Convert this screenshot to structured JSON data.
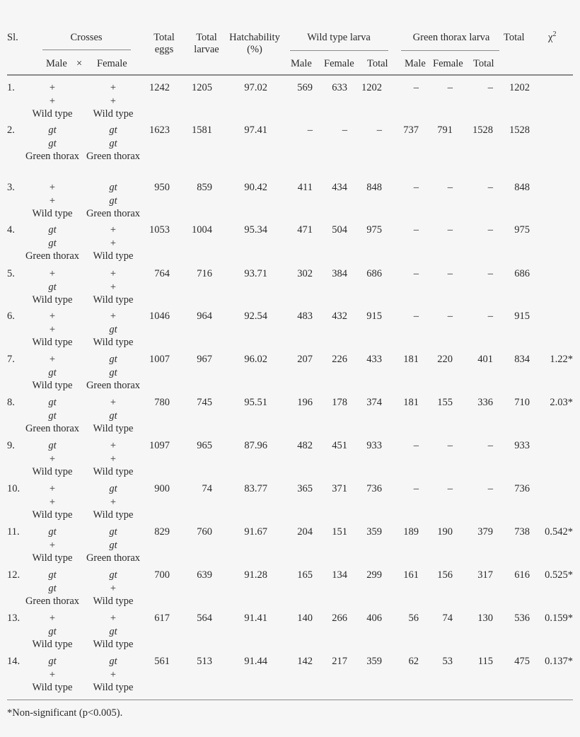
{
  "table": {
    "header": {
      "sl": "Sl.",
      "crosses": "Crosses",
      "male": "Male",
      "times": "×",
      "female": "Female",
      "total_eggs": [
        "Total",
        "eggs"
      ],
      "total_larvae": [
        "Total",
        "larvae"
      ],
      "hatchability": [
        "Hatchability",
        "(%)"
      ],
      "wild_type_larva": "Wild type larva",
      "green_thorax_larva": "Green thorax larva",
      "sub_male": "Male",
      "sub_female": "Female",
      "sub_total": "Total",
      "total": "Total",
      "chi": "χ",
      "chi_sup": "2"
    },
    "rows": [
      {
        "sl": "1.",
        "m1": "+",
        "m2": "+",
        "mp": "Wild type",
        "f1": "+",
        "f2": "+",
        "fp": "Wild type",
        "eggs": "1242",
        "larvae": "1205",
        "hatch": "97.02",
        "wm": "569",
        "wf": "633",
        "wt": "1202",
        "gm": "–",
        "gf": "–",
        "gt": "–",
        "total": "1202",
        "chi": ""
      },
      {
        "sl": "2.",
        "m1": "gt",
        "m2": "gt",
        "mp": "Green thorax",
        "f1": "gt",
        "f2": "gt",
        "fp": "Green thorax",
        "eggs": "1623",
        "larvae": "1581",
        "hatch": "97.41",
        "wm": "–",
        "wf": "–",
        "wt": "–",
        "gm": "737",
        "gf": "791",
        "gt": "1528",
        "total": "1528",
        "chi": ""
      },
      {
        "sl": "3.",
        "m1": "+",
        "m2": "+",
        "mp": "Wild type",
        "f1": "gt",
        "f2": "gt",
        "fp": "Green thorax",
        "eggs": "950",
        "larvae": "859",
        "hatch": "90.42",
        "wm": "411",
        "wf": "434",
        "wt": "848",
        "gm": "–",
        "gf": "–",
        "gt": "–",
        "total": "848",
        "chi": ""
      },
      {
        "sl": "4.",
        "m1": "gt",
        "m2": "gt",
        "mp": "Green thorax",
        "f1": "+",
        "f2": "+",
        "fp": "Wild type",
        "eggs": "1053",
        "larvae": "1004",
        "hatch": "95.34",
        "wm": "471",
        "wf": "504",
        "wt": "975",
        "gm": "–",
        "gf": "–",
        "gt": "–",
        "total": "975",
        "chi": ""
      },
      {
        "sl": "5.",
        "m1": "+",
        "m2": "gt",
        "mp": "Wild type",
        "f1": "+",
        "f2": "+",
        "fp": "Wild type",
        "eggs": "764",
        "larvae": "716",
        "hatch": "93.71",
        "wm": "302",
        "wf": "384",
        "wt": "686",
        "gm": "–",
        "gf": "–",
        "gt": "–",
        "total": "686",
        "chi": ""
      },
      {
        "sl": "6.",
        "m1": "+",
        "m2": "+",
        "mp": "Wild type",
        "f1": "+",
        "f2": "gt",
        "fp": "Wild type",
        "eggs": "1046",
        "larvae": "964",
        "hatch": "92.54",
        "wm": "483",
        "wf": "432",
        "wt": "915",
        "gm": "–",
        "gf": "–",
        "gt": "–",
        "total": "915",
        "chi": ""
      },
      {
        "sl": "7.",
        "m1": "+",
        "m2": "gt",
        "mp": "Wild type",
        "f1": "gt",
        "f2": "gt",
        "fp": "Green thorax",
        "eggs": "1007",
        "larvae": "967",
        "hatch": "96.02",
        "wm": "207",
        "wf": "226",
        "wt": "433",
        "gm": "181",
        "gf": "220",
        "gt": "401",
        "total": "834",
        "chi": "1.22*"
      },
      {
        "sl": "8.",
        "m1": "gt",
        "m2": "gt",
        "mp": "Green thorax",
        "f1": "+",
        "f2": "gt",
        "fp": "Wild type",
        "eggs": "780",
        "larvae": "745",
        "hatch": "95.51",
        "wm": "196",
        "wf": "178",
        "wt": "374",
        "gm": "181",
        "gf": "155",
        "gt": "336",
        "total": "710",
        "chi": "2.03*"
      },
      {
        "sl": "9.",
        "m1": "gt",
        "m2": "+",
        "mp": "Wild type",
        "f1": "+",
        "f2": "+",
        "fp": "Wild type",
        "eggs": "1097",
        "larvae": "965",
        "hatch": "87.96",
        "wm": "482",
        "wf": "451",
        "wt": "933",
        "gm": "–",
        "gf": "–",
        "gt": "–",
        "total": "933",
        "chi": ""
      },
      {
        "sl": "10.",
        "m1": "+",
        "m2": "+",
        "mp": "Wild type",
        "f1": "gt",
        "f2": "+",
        "fp": "Wild type",
        "eggs": "900",
        "larvae": "74",
        "hatch": "83.77",
        "wm": "365",
        "wf": "371",
        "wt": "736",
        "gm": "–",
        "gf": "–",
        "gt": "–",
        "total": "736",
        "chi": ""
      },
      {
        "sl": "11.",
        "m1": "gt",
        "m2": "+",
        "mp": "Wild type",
        "f1": "gt",
        "f2": "gt",
        "fp": "Green thorax",
        "eggs": "829",
        "larvae": "760",
        "hatch": "91.67",
        "wm": "204",
        "wf": "151",
        "wt": "359",
        "gm": "189",
        "gf": "190",
        "gt": "379",
        "total": "738",
        "chi": "0.542*"
      },
      {
        "sl": "12.",
        "m1": "gt",
        "m2": "gt",
        "mp": "Green thorax",
        "f1": "gt",
        "f2": "+",
        "fp": "Wild type",
        "eggs": "700",
        "larvae": "639",
        "hatch": "91.28",
        "wm": "165",
        "wf": "134",
        "wt": "299",
        "gm": "161",
        "gf": "156",
        "gt": "317",
        "total": "616",
        "chi": "0.525*"
      },
      {
        "sl": "13.",
        "m1": "+",
        "m2": "gt",
        "mp": "Wild type",
        "f1": "+",
        "f2": "gt",
        "fp": "Wild type",
        "eggs": "617",
        "larvae": "564",
        "hatch": "91.41",
        "wm": "140",
        "wf": "266",
        "wt": "406",
        "gm": "56",
        "gf": "74",
        "gt": "130",
        "total": "536",
        "chi": "0.159*"
      },
      {
        "sl": "14.",
        "m1": "gt",
        "m2": "+",
        "mp": "Wild type",
        "f1": "gt",
        "f2": "+",
        "fp": "Wild type",
        "eggs": "561",
        "larvae": "513",
        "hatch": "91.44",
        "wm": "142",
        "wf": "217",
        "wt": "359",
        "gm": "62",
        "gf": "53",
        "gt": "115",
        "total": "475",
        "chi": "0.137*"
      }
    ],
    "footnote": "*Non-significant (p<0.005)."
  }
}
